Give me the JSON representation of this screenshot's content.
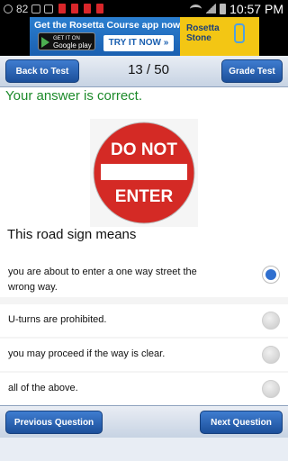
{
  "status_bar": {
    "notification_count": "82",
    "time": "10:57 PM",
    "icons": [
      "usb-icon",
      "message-icon",
      "app-icon",
      "app-icon",
      "app-icon",
      "app-icon",
      "app-icon",
      "wifi-icon",
      "signal-icon",
      "battery-icon"
    ]
  },
  "ad": {
    "headline": "Get the Rosetta Course app now.",
    "store_line1": "GET IT ON",
    "store_line2": "Google play",
    "cta": "TRY IT NOW »",
    "brand_line1": "Rosetta",
    "brand_line2": "Stone"
  },
  "nav": {
    "back_label": "Back to Test",
    "progress": "13 / 50",
    "grade_label": "Grade Test"
  },
  "result_text": "Your answer is correct.",
  "sign": {
    "line1": "DO NOT",
    "line2": "ENTER",
    "color": "#d42a25"
  },
  "question": "This road sign means",
  "answers": [
    {
      "text": "you are about to enter a one way street the wrong way.",
      "selected": true
    },
    {
      "text": "U-turns are prohibited.",
      "selected": false
    },
    {
      "text": "you may proceed if the way is clear.",
      "selected": false
    },
    {
      "text": "all of the above.",
      "selected": false
    }
  ],
  "bottom": {
    "prev_label": "Previous Question",
    "next_label": "Next Question"
  },
  "colors": {
    "accent": "#1c4f9a",
    "correct": "#1c8a2a",
    "radio_selected": "#2f6fcf"
  }
}
